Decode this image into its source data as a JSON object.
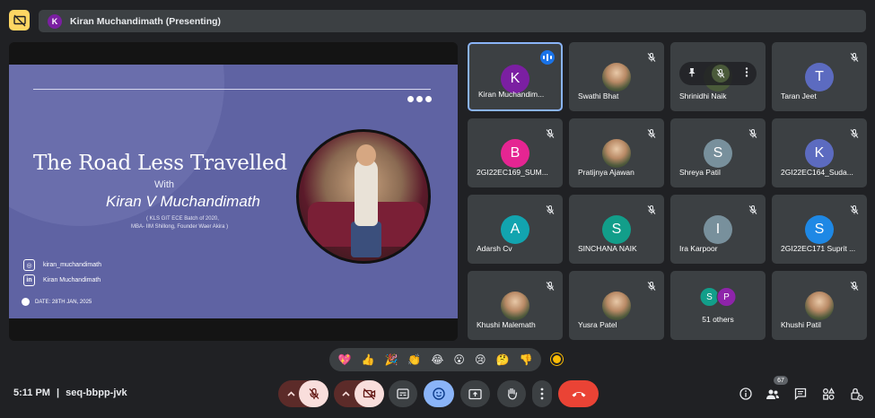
{
  "presentation_banner": {
    "avatar_letter": "K",
    "text": "Kiran Muchandimath (Presenting)"
  },
  "slide": {
    "title": "The Road Less Travelled",
    "with": "With",
    "name": "Kiran V Muchandimath",
    "sub_line1": "( KLS GIT ECE Batch of 2020,",
    "sub_line2": "MBA- IIM Shillong, Founder Waer Akira )",
    "instagram": "kiran_muchandimath",
    "linkedin": "Kiran Muchandimath",
    "date": "DATE: 28TH JAN, 2025"
  },
  "participants": [
    {
      "name": "Kiran Muchandim...",
      "letter": "K",
      "color": "#7b1fa2",
      "speaking": true
    },
    {
      "name": "Swathi Bhat",
      "letter": "",
      "photo": true
    },
    {
      "name": "Shrinidhi Naik",
      "letter": "S",
      "color": "#4a5a3a",
      "hovered": true
    },
    {
      "name": "Taran Jeet",
      "letter": "T",
      "color": "#5c6bc0"
    },
    {
      "name": "2GI22EC169_SUM...",
      "letter": "B",
      "color": "#e52592"
    },
    {
      "name": "Pratijnya Ajawan",
      "letter": "",
      "photo": true
    },
    {
      "name": "Shreya Patil",
      "letter": "S",
      "color": "#78909c"
    },
    {
      "name": "2GI22EC164_Suda...",
      "letter": "K",
      "color": "#5c6bc0"
    },
    {
      "name": "Adarsh Cv",
      "letter": "A",
      "color": "#12a4af"
    },
    {
      "name": "SINCHANA NAIK",
      "letter": "S",
      "color": "#129e8a"
    },
    {
      "name": "Ira Karpoor",
      "letter": "I",
      "color": "#78909c"
    },
    {
      "name": "2GI22EC171 Suprit ...",
      "letter": "S",
      "color": "#1e88e5"
    },
    {
      "name": "Khushi Malemath",
      "letter": "",
      "photo": true
    },
    {
      "name": "Yusra Patel",
      "letter": "",
      "photo": true
    },
    {
      "name": "51 others",
      "letters": [
        "S",
        "P"
      ],
      "colors": [
        "#129e8a",
        "#8e24aa"
      ]
    },
    {
      "name": "Khushi Patil",
      "letter": "",
      "photo": true
    }
  ],
  "reactions": [
    "💖",
    "👍",
    "🎉",
    "👏",
    "😂",
    "😮",
    "😢",
    "🤔",
    "👎"
  ],
  "meeting": {
    "time": "5:11 PM",
    "separator": "|",
    "code": "seq-bbpp-jvk"
  },
  "people_count": "67",
  "colors": {
    "end_call": "#ea4335",
    "accent": "#8ab4f8",
    "mic_off_bg": "#f9dedc"
  }
}
